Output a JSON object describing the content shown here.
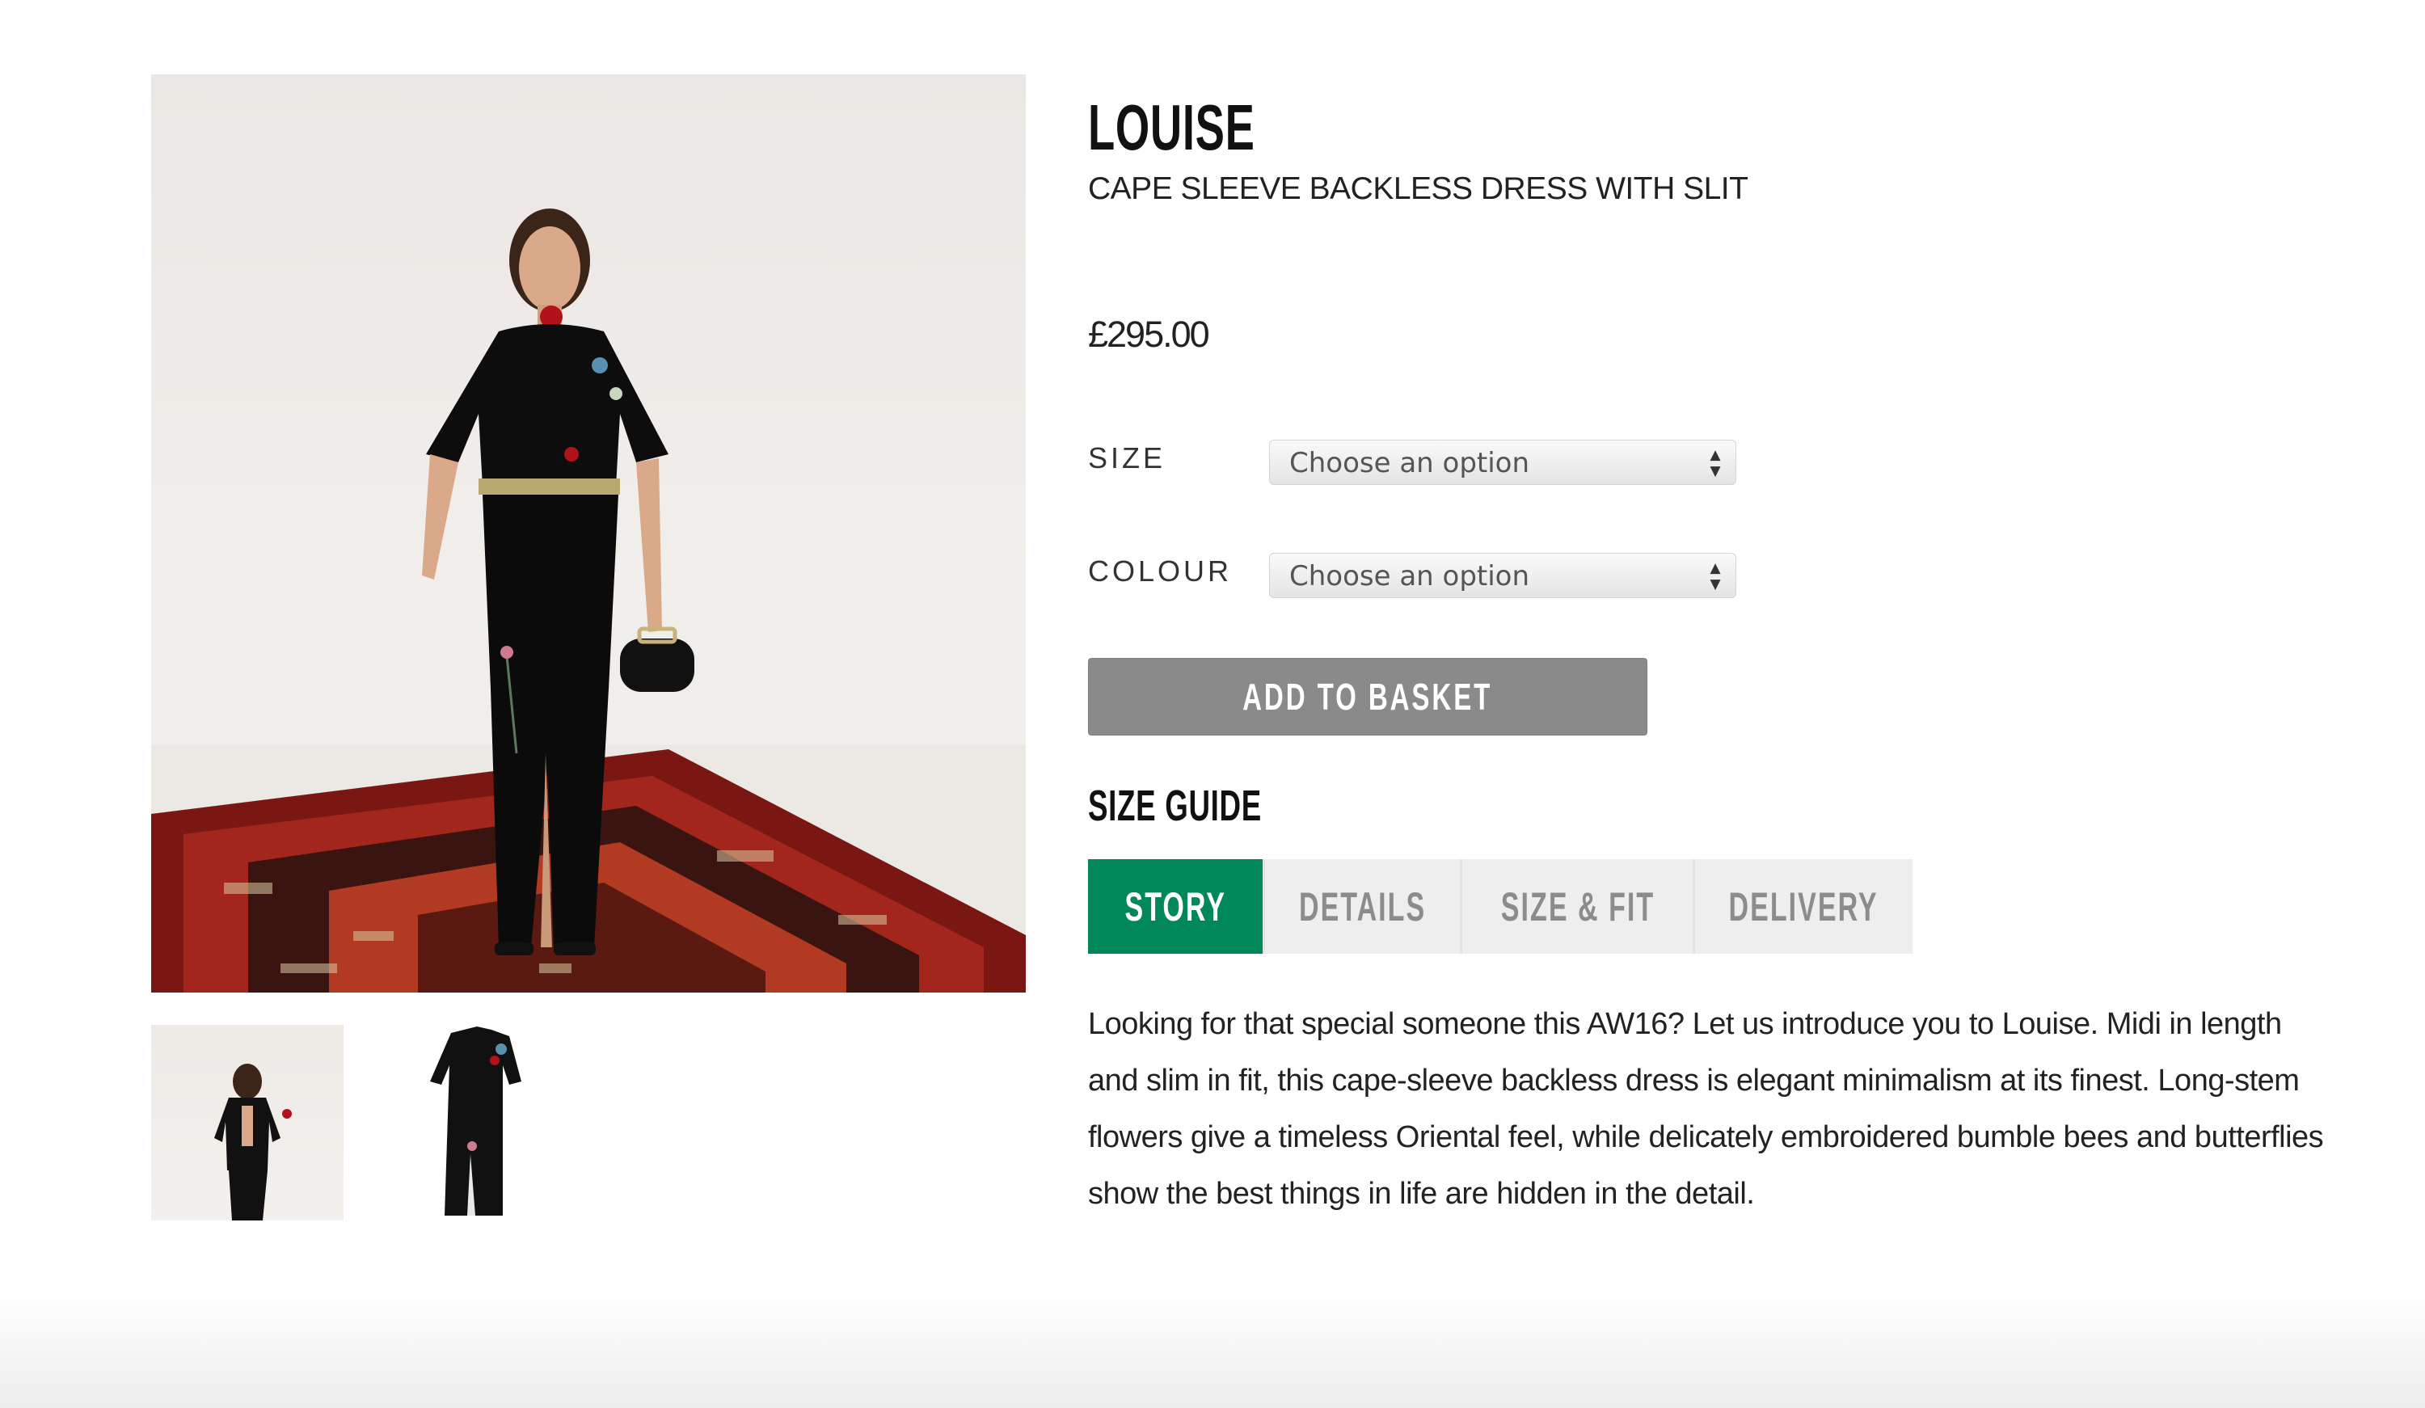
{
  "product": {
    "name": "LOUISE",
    "subtitle": "CAPE SLEEVE BACKLESS DRESS WITH SLIT",
    "price": "£295.00"
  },
  "options": {
    "size": {
      "label": "SIZE",
      "selected": "Choose an option"
    },
    "colour": {
      "label": "COLOUR",
      "selected": "Choose an option"
    }
  },
  "actions": {
    "add_to_basket": "ADD TO BASKET"
  },
  "size_guide": {
    "heading": "SIZE GUIDE"
  },
  "tabs": [
    {
      "label": "STORY",
      "active": true
    },
    {
      "label": "DETAILS",
      "active": false
    },
    {
      "label": "SIZE & FIT",
      "active": false
    },
    {
      "label": "DELIVERY",
      "active": false
    }
  ],
  "description": "Looking for that special someone this AW16? Let us introduce you to Louise. Midi in length and slim in fit, this cape-sleeve backless dress is elegant minimalism at its finest. Long-stem flowers give a timeless Oriental feel, while delicately embroidered bumble bees and butterflies show the best things in life are hidden in the detail.",
  "colors": {
    "accent": "#00875a",
    "button": "#8a8a8a",
    "tab_inactive": "#eeeeee"
  }
}
